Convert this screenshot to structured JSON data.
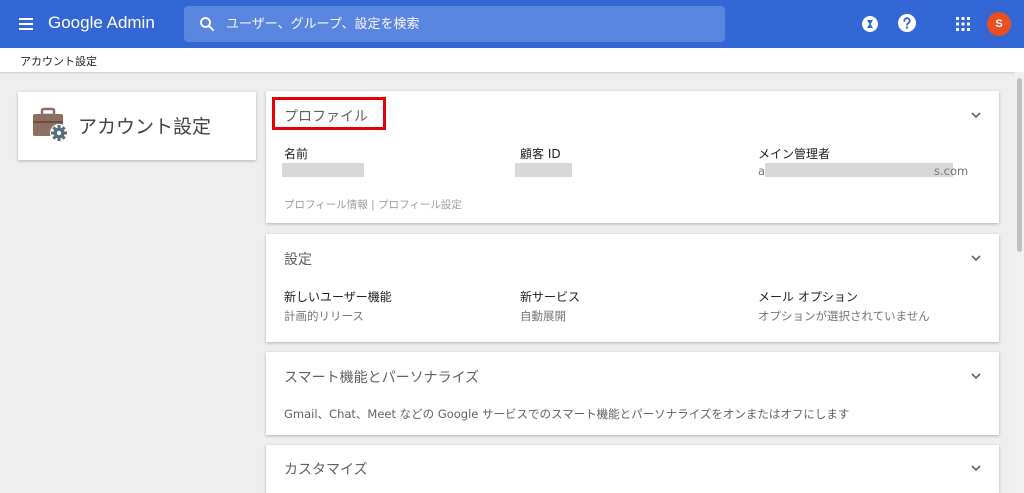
{
  "header": {
    "brand": "Google Admin",
    "search_placeholder": "ユーザー、グループ、設定を検索",
    "avatar_letter": "S",
    "bar_color": "#3367d6",
    "avatar_color": "#e8501f"
  },
  "breadcrumb": "アカウント設定",
  "left_card": {
    "title": "アカウント設定"
  },
  "profile": {
    "title": "プロファイル",
    "fields": [
      {
        "label": "名前",
        "value": ""
      },
      {
        "label": "顧客 ID",
        "value": ""
      },
      {
        "label": "メイン管理者",
        "value_start": "a",
        "value_end": "s.com"
      }
    ],
    "link_info": "プロフィール情報",
    "link_sep": "|",
    "link_settings": "プロフィール設定"
  },
  "settings": {
    "title": "設定",
    "fields": [
      {
        "label": "新しいユーザー機能",
        "value": "計画的リリース"
      },
      {
        "label": "新サービス",
        "value": "自動展開"
      },
      {
        "label": "メール オプション",
        "value": "オプションが選択されていません"
      }
    ]
  },
  "smart": {
    "title": "スマート機能とパーソナライズ",
    "description": "Gmail、Chat、Meet などの Google サービスでのスマート機能とパーソナライズをオンまたはオフにします"
  },
  "customize": {
    "title": "カスタマイズ"
  },
  "highlight_color": "#e60000"
}
